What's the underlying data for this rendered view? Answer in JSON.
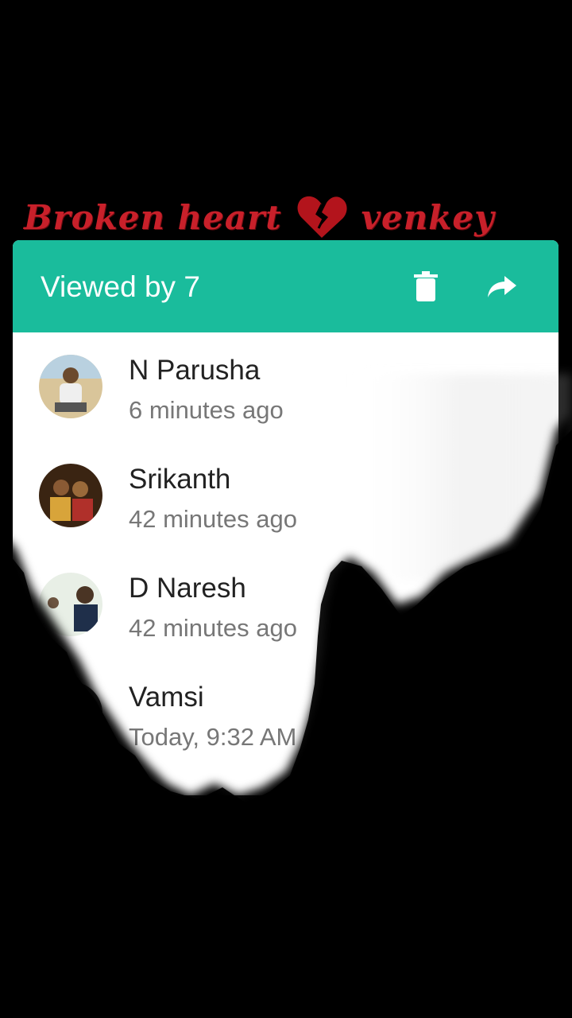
{
  "brand": {
    "text_left": "Broken heart",
    "text_right": "venkey",
    "color": "#c8202a"
  },
  "header": {
    "title": "Viewed by 7",
    "delete_icon": "trash-icon",
    "forward_icon": "forward-arrow-icon",
    "background": "#1abc9c"
  },
  "viewers": [
    {
      "name": "N Parusha",
      "time": "6 minutes ago"
    },
    {
      "name": "Srikanth",
      "time": "42 minutes ago"
    },
    {
      "name": "D Naresh",
      "time": "42 minutes ago"
    },
    {
      "name": "Vamsi",
      "time": "Today, 9:32 AM"
    },
    {
      "name": "",
      "time": ""
    },
    {
      "name": "",
      "time": ""
    }
  ]
}
